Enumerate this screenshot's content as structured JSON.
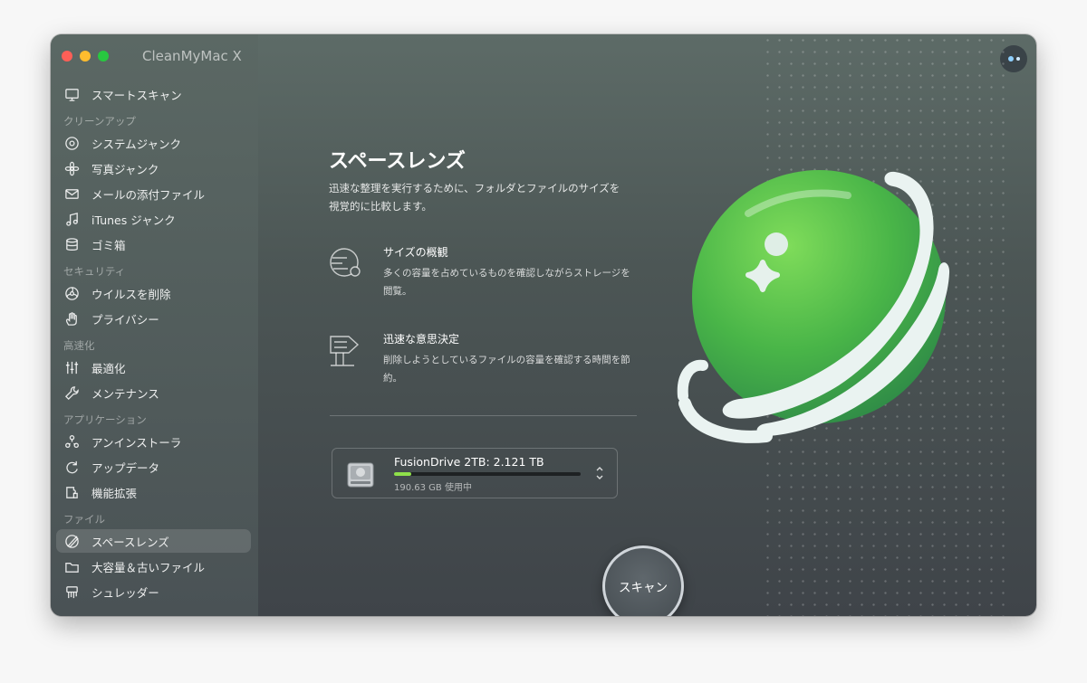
{
  "app": {
    "title": "CleanMyMac X"
  },
  "sidebar": {
    "items": [
      {
        "type": "item",
        "label": "スマートスキャン",
        "icon": "monitor-icon"
      },
      {
        "type": "section",
        "label": "クリーンアップ"
      },
      {
        "type": "item",
        "label": "システムジャンク",
        "icon": "disc-icon"
      },
      {
        "type": "item",
        "label": "写真ジャンク",
        "icon": "flower-icon"
      },
      {
        "type": "item",
        "label": "メールの添付ファイル",
        "icon": "mail-icon"
      },
      {
        "type": "item",
        "label": "iTunes ジャンク",
        "icon": "music-icon"
      },
      {
        "type": "item",
        "label": "ゴミ箱",
        "icon": "bin-icon"
      },
      {
        "type": "section",
        "label": "セキュリティ"
      },
      {
        "type": "item",
        "label": "ウイルスを削除",
        "icon": "biohazard-icon"
      },
      {
        "type": "item",
        "label": "プライバシー",
        "icon": "hand-icon"
      },
      {
        "type": "section",
        "label": "高速化"
      },
      {
        "type": "item",
        "label": "最適化",
        "icon": "sliders-icon"
      },
      {
        "type": "item",
        "label": "メンテナンス",
        "icon": "wrench-icon"
      },
      {
        "type": "section",
        "label": "アプリケーション"
      },
      {
        "type": "item",
        "label": "アンインストーラ",
        "icon": "apps-icon"
      },
      {
        "type": "item",
        "label": "アップデータ",
        "icon": "update-icon"
      },
      {
        "type": "item",
        "label": "機能拡張",
        "icon": "extension-icon"
      },
      {
        "type": "section",
        "label": "ファイル"
      },
      {
        "type": "item",
        "label": "スペースレンズ",
        "icon": "space-lens-icon",
        "active": true
      },
      {
        "type": "item",
        "label": "大容量＆古いファイル",
        "icon": "folder-icon"
      },
      {
        "type": "item",
        "label": "シュレッダー",
        "icon": "shredder-icon"
      }
    ]
  },
  "main": {
    "title": "スペースレンズ",
    "description": "迅速な整理を実行するために、フォルダとファイルのサイズを視覚的に比較します。",
    "features": [
      {
        "title": "サイズの概観",
        "text": "多くの容量を占めているものを確認しながらストレージを閲覧。",
        "icon": "size-overview-icon"
      },
      {
        "title": "迅速な意思決定",
        "text": "削除しようとしているファイルの容量を確認する時間を節約。",
        "icon": "decision-icon"
      }
    ],
    "disk": {
      "name": "FusionDrive 2TB: 2.121 TB",
      "used": "190.63 GB 使用中",
      "used_fraction": 0.09
    },
    "scan_label": "スキャン"
  }
}
